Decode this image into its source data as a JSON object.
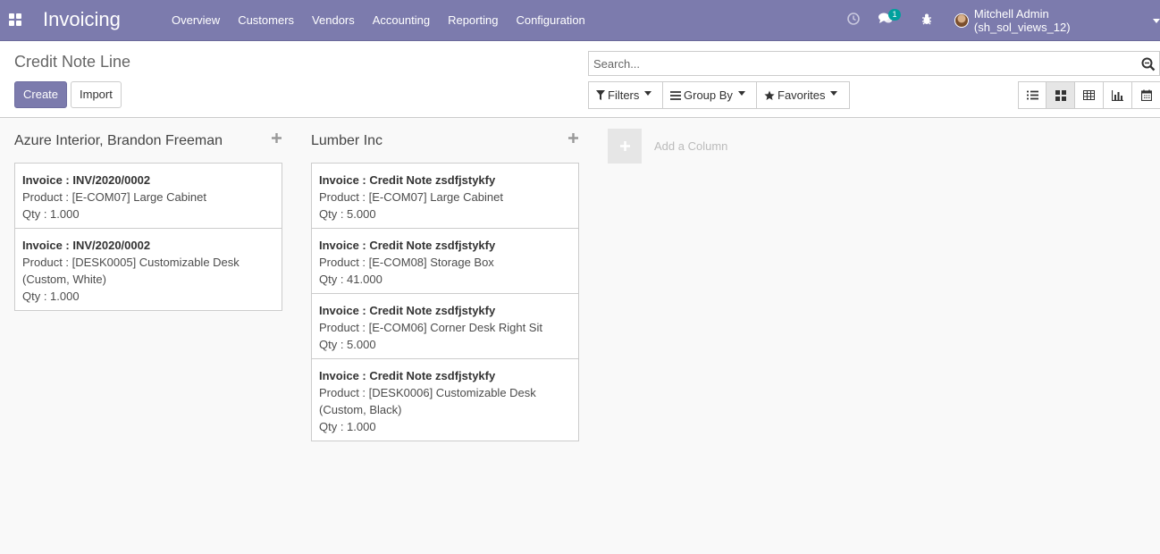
{
  "navbar": {
    "apps_icon": "apps-grid-icon",
    "brand": "Invoicing",
    "menu": [
      "Overview",
      "Customers",
      "Vendors",
      "Accounting",
      "Reporting",
      "Configuration"
    ],
    "activity_icon": "clock-icon",
    "messages_icon": "chat-icon",
    "messages_count": "1",
    "debug_icon": "bug-icon",
    "user_name": "Mitchell Admin (sh_sol_views_12)",
    "accent": "#7c7bad"
  },
  "control_panel": {
    "title": "Credit Note Line",
    "create_label": "Create",
    "import_label": "Import",
    "search_placeholder": "Search...",
    "filters_label": "Filters",
    "groupby_label": "Group By",
    "favorites_label": "Favorites",
    "views": [
      "list-view-icon",
      "kanban-view-icon",
      "pivot-view-icon",
      "graph-view-icon",
      "calendar-view-icon"
    ],
    "active_view": "kanban-view-icon"
  },
  "kanban": {
    "columns": [
      {
        "title": "Azure Interior, Brandon Freeman",
        "cards": [
          {
            "invoice": "Invoice : INV/2020/0002",
            "product": "Product : [E-COM07] Large Cabinet",
            "qty": "Qty : 1.000"
          },
          {
            "invoice": "Invoice : INV/2020/0002",
            "product": "Product : [DESK0005] Customizable Desk (Custom, White)",
            "qty": "Qty : 1.000"
          }
        ]
      },
      {
        "title": "Lumber Inc",
        "cards": [
          {
            "invoice": "Invoice : Credit Note zsdfjstykfy",
            "product": "Product : [E-COM07] Large Cabinet",
            "qty": "Qty : 5.000"
          },
          {
            "invoice": "Invoice : Credit Note zsdfjstykfy",
            "product": "Product : [E-COM08] Storage Box",
            "qty": "Qty : 41.000"
          },
          {
            "invoice": "Invoice : Credit Note zsdfjstykfy",
            "product": "Product : [E-COM06] Corner Desk Right Sit",
            "qty": "Qty : 5.000"
          },
          {
            "invoice": "Invoice : Credit Note zsdfjstykfy",
            "product": "Product : [DESK0006] Customizable Desk (Custom, Black)",
            "qty": "Qty : 1.000"
          }
        ]
      }
    ],
    "add_column_label": "Add a Column"
  }
}
